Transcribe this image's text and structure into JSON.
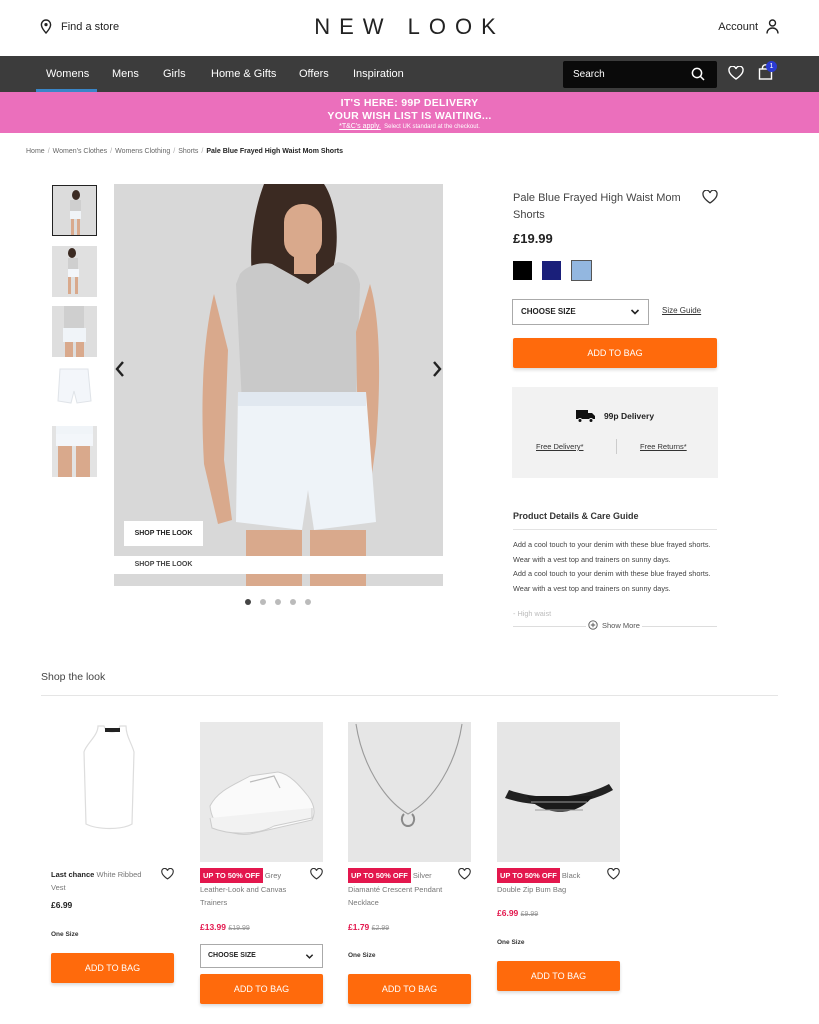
{
  "header": {
    "find_store": "Find a store",
    "logo": "NEW LOOK",
    "account": "Account"
  },
  "nav": {
    "items": [
      "Womens",
      "Mens",
      "Girls",
      "Home & Gifts",
      "Offers",
      "Inspiration"
    ],
    "active": "Womens",
    "search_placeholder": "Search",
    "bag_count": "1"
  },
  "promo": {
    "line1": "IT'S HERE: 99P DELIVERY",
    "line2": "YOUR WISH LIST IS WAITING...",
    "tc_link": "*T&C's apply.",
    "tc_note": "Select UK standard at the checkout."
  },
  "breadcrumb": [
    "Home",
    "Women's Clothes",
    "Womens Clothing",
    "Shorts",
    "Pale Blue Frayed High Waist Mom Shorts"
  ],
  "gallery": {
    "shop_the_look_button": "SHOP THE LOOK",
    "dots": 5,
    "active_dot": 1
  },
  "product": {
    "title": "Pale Blue Frayed High Waist Mom Shorts",
    "price": "£19.99",
    "swatches": [
      "#000000",
      "#1a1f7a",
      "#93b7e0"
    ],
    "size_select": "CHOOSE SIZE",
    "size_guide": "Size Guide",
    "add_to_bag": "ADD TO BAG",
    "delivery_title": "99p Delivery",
    "free_delivery": "Free Delivery*",
    "free_returns": "Free Returns*",
    "details_heading": "Product Details & Care Guide",
    "details_text": "Add a cool touch to your denim with these blue frayed shorts. Wear with a vest top and trainers on sunny days.",
    "details_faded": "- High waist",
    "show_more": "Show More"
  },
  "shop_the_look": {
    "title": "Shop the look",
    "items": [
      {
        "badge": "Last chance",
        "name": "White Ribbed Vest",
        "price": "£6.99",
        "was": "",
        "size": "One Size",
        "button": "ADD TO BAG"
      },
      {
        "badge": "UP TO 50% OFF",
        "name": "Grey Leather-Look and Canvas Trainers",
        "price": "£13.99",
        "was": "£19.99",
        "size": "CHOOSE SIZE",
        "button": "ADD TO BAG"
      },
      {
        "badge": "UP TO 50% OFF",
        "name": "Silver Diamanté Crescent Pendant Necklace",
        "price": "£1.79",
        "was": "£2.99",
        "size": "One Size",
        "button": "ADD TO BAG"
      },
      {
        "badge": "UP TO 50% OFF",
        "name": "Black Double Zip Bum Bag",
        "price": "£6.99",
        "was": "£9.99",
        "size": "One Size",
        "button": "ADD TO BAG"
      }
    ]
  },
  "colors": {
    "accent": "#ff6a0c",
    "promo": "#eb6fbc",
    "nav": "#3c3c3c",
    "sale": "#e3174d"
  }
}
